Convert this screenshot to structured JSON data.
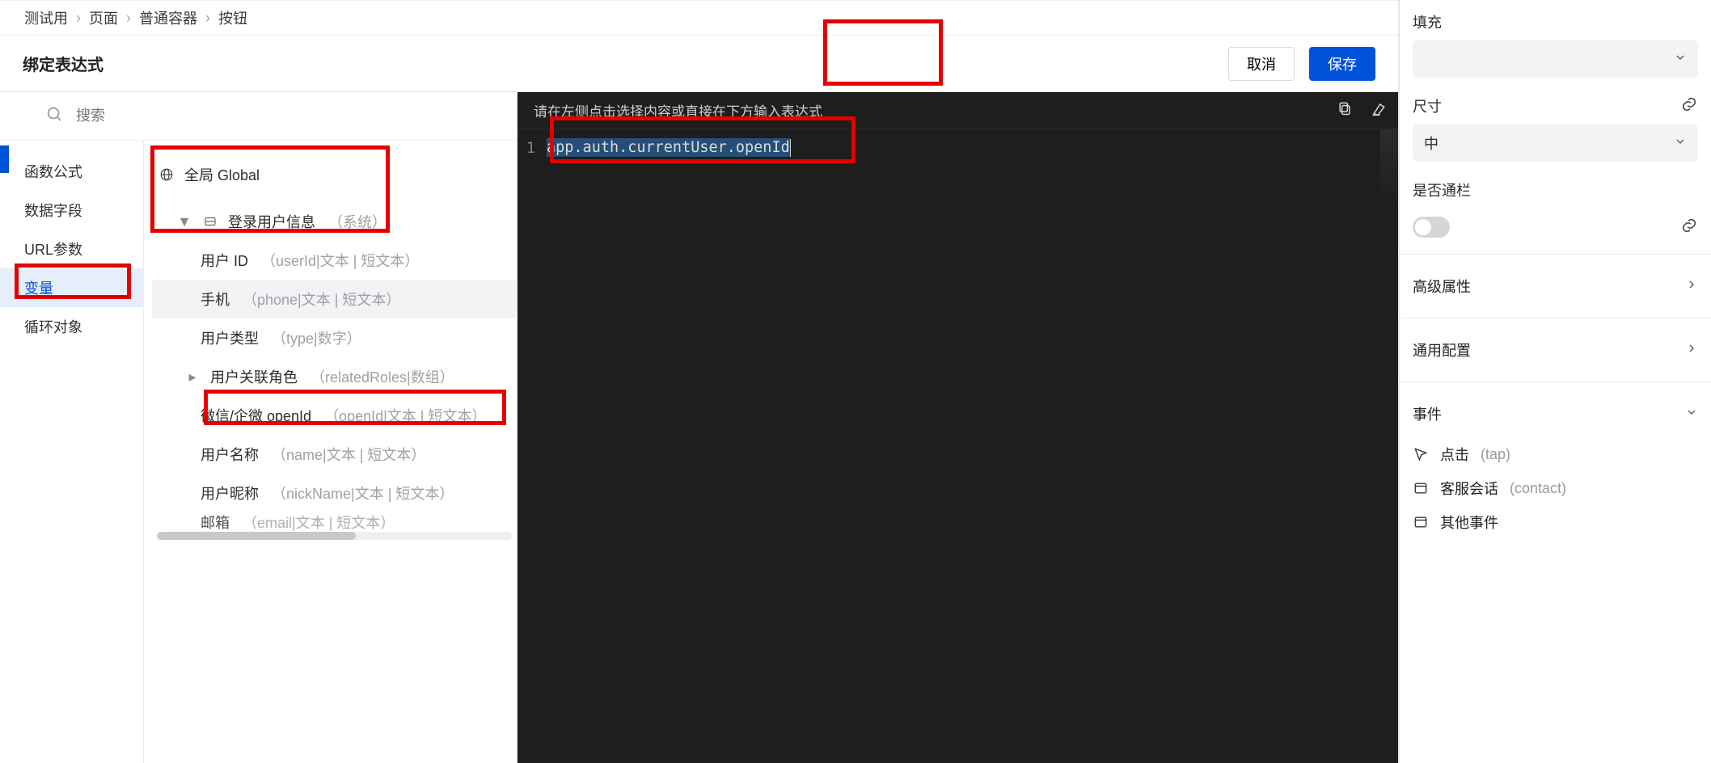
{
  "breadcrumb": [
    "测试用",
    "页面",
    "普通容器",
    "按钮"
  ],
  "modal": {
    "title": "绑定表达式",
    "cancel": "取消",
    "save": "保存"
  },
  "search": {
    "placeholder": "搜索"
  },
  "categories": [
    {
      "label": "函数公式"
    },
    {
      "label": "数据字段"
    },
    {
      "label": "URL参数"
    },
    {
      "label": "变量",
      "active": true
    },
    {
      "label": "循环对象"
    }
  ],
  "tree": {
    "global": {
      "label": "全局 Global"
    },
    "loginUser": {
      "label": "登录用户信息",
      "tag": "（系统）"
    },
    "items": [
      {
        "title": "用户 ID",
        "meta": "（userId|文本 | 短文本）"
      },
      {
        "title": "手机",
        "meta": "（phone|文本 | 短文本）",
        "hover": true
      },
      {
        "title": "用户类型",
        "meta": "（type|数字）"
      },
      {
        "title": "用户关联角色",
        "meta": "（relatedRoles|数组）",
        "expandable": true
      },
      {
        "title": "微信/企微 openId",
        "meta": "（openId|文本 | 短文本）"
      },
      {
        "title": "用户名称",
        "meta": "（name|文本 | 短文本）"
      },
      {
        "title": "用户昵称",
        "meta": "（nickName|文本 | 短文本）"
      },
      {
        "title": "邮箱",
        "meta": "（email|文本 | 短文本）",
        "cut": true
      }
    ]
  },
  "editor": {
    "hint": "请在左侧点击选择内容或直接在下方输入表达式",
    "line_no": "1",
    "code": "app.auth.currentUser.openId"
  },
  "inspector": {
    "fill_label": "填充",
    "size_label": "尺寸",
    "size_value": "中",
    "full_width_label": "是否通栏",
    "advanced": "高级属性",
    "general": "通用配置",
    "events_header": "事件",
    "events": [
      {
        "label": "点击",
        "hint": "(tap)",
        "icon": "cursor"
      },
      {
        "label": "客服会话",
        "hint": "(contact)",
        "icon": "card"
      },
      {
        "label": "其他事件",
        "hint": "",
        "icon": "card"
      }
    ]
  }
}
